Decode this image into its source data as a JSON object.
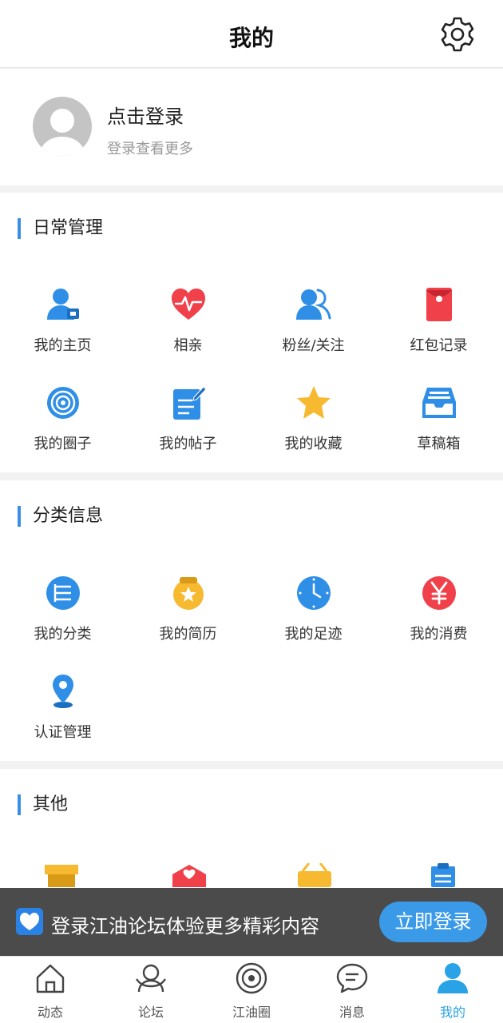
{
  "header": {
    "title": "我的"
  },
  "profile": {
    "login_label": "点击登录",
    "subtitle": "登录查看更多"
  },
  "sections": {
    "daily": {
      "title": "日常管理",
      "items": [
        {
          "label": "我的主页",
          "icon": "user-home-icon"
        },
        {
          "label": "相亲",
          "icon": "heart-pulse-icon"
        },
        {
          "label": "粉丝/关注",
          "icon": "fans-icon"
        },
        {
          "label": "红包记录",
          "icon": "red-envelope-icon"
        },
        {
          "label": "我的圈子",
          "icon": "circle-target-icon"
        },
        {
          "label": "我的帖子",
          "icon": "edit-post-icon"
        },
        {
          "label": "我的收藏",
          "icon": "star-icon"
        },
        {
          "label": "草稿箱",
          "icon": "inbox-tray-icon"
        }
      ]
    },
    "classified": {
      "title": "分类信息",
      "items": [
        {
          "label": "我的分类",
          "icon": "list-icon"
        },
        {
          "label": "我的简历",
          "icon": "resume-icon"
        },
        {
          "label": "我的足迹",
          "icon": "clock-icon"
        },
        {
          "label": "我的消费",
          "icon": "yuan-icon"
        },
        {
          "label": "认证管理",
          "icon": "location-pin-icon"
        }
      ]
    },
    "other": {
      "title": "其他"
    }
  },
  "banner": {
    "text": "登录江油论坛体验更多精彩内容",
    "button": "立即登录"
  },
  "tabs": [
    {
      "label": "动态",
      "icon": "home-icon"
    },
    {
      "label": "论坛",
      "icon": "forum-icon"
    },
    {
      "label": "江油圈",
      "icon": "planet-icon"
    },
    {
      "label": "消息",
      "icon": "chat-bubble-icon"
    },
    {
      "label": "我的",
      "icon": "profile-icon"
    }
  ],
  "colors": {
    "accent": "#3a8ee6",
    "active_tab": "#2aa3e6",
    "red": "#f0404a",
    "yellow": "#f6b930"
  }
}
